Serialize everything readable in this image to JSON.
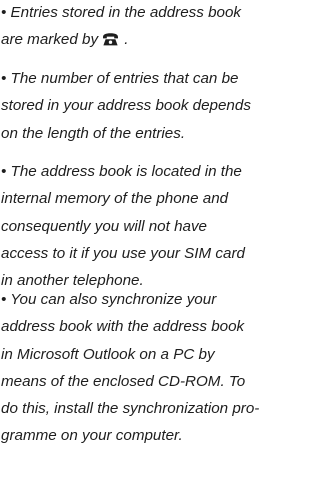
{
  "paragraphs": [
    {
      "lines": [
        "• Entries stored in the address book",
        "are marked by"
      ],
      "trailing_after_icon": " .",
      "icon": "telephone-icon"
    },
    {
      "lines": [
        "• The number of entries that can be",
        "stored in your address book depends",
        "on the length of the entries."
      ]
    },
    {
      "lines": [
        "• The address book is located in the",
        "internal memory of the phone and",
        "consequently you will not have",
        "access to it if you use your SIM card",
        "in another telephone."
      ]
    },
    {
      "lines": [
        "• You can also synchronize your",
        "address book with the address book",
        "in Microsoft Outlook on a PC by",
        "means of the enclosed CD-ROM. To",
        "do this, install the synchronization pro-",
        "gramme on your computer."
      ]
    }
  ],
  "colors": {
    "text": "#1e1e1e",
    "background": "#ffffff"
  }
}
